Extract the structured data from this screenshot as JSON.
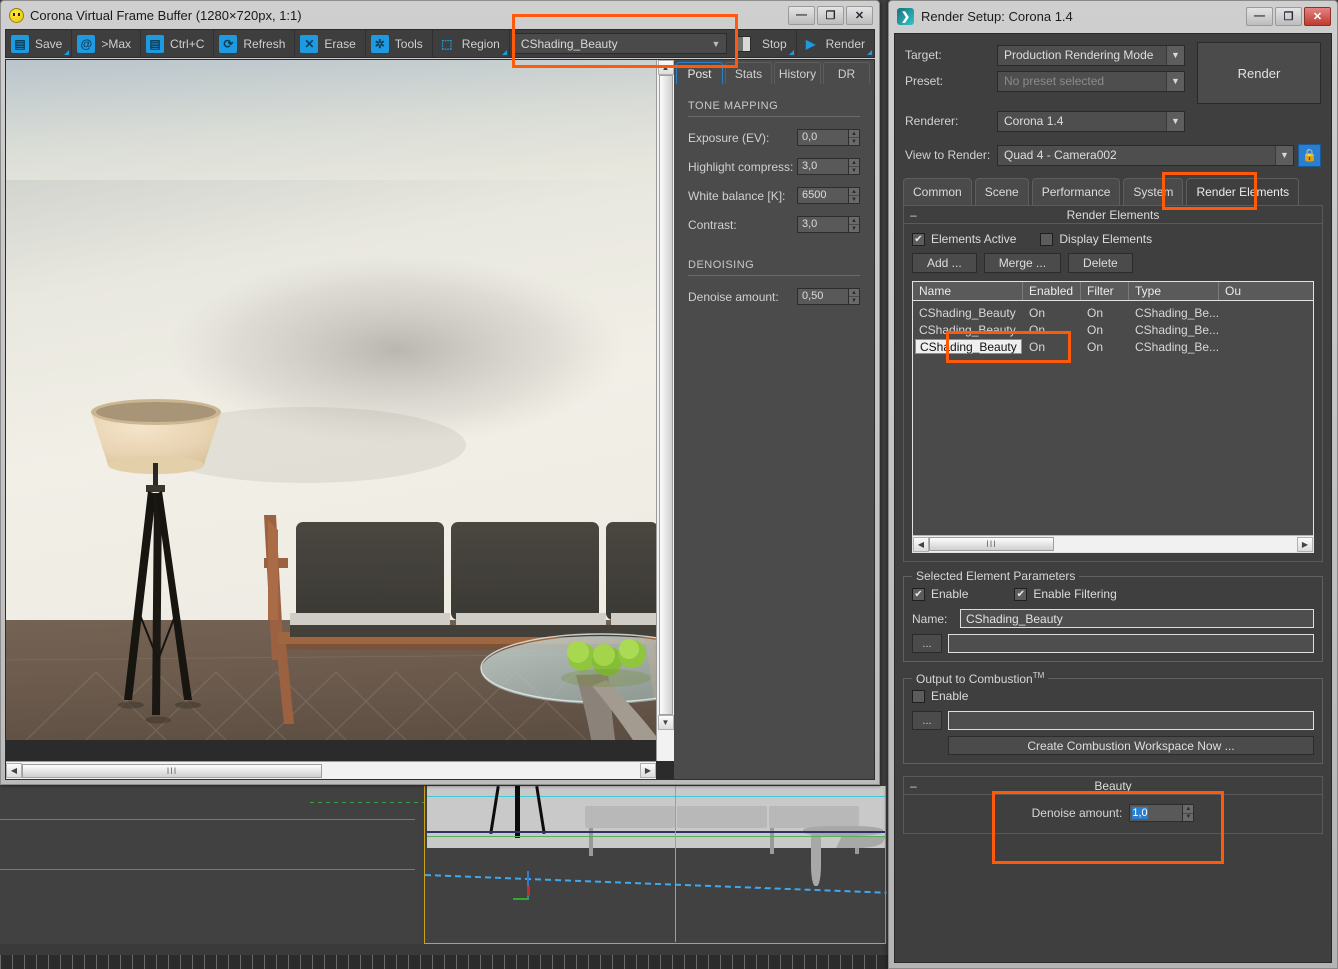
{
  "vfb": {
    "title": "Corona Virtual Frame Buffer (1280×720px, 1:1)",
    "icon": "smiley-icon",
    "window_buttons": {
      "minimize": "—",
      "maximize": "❐",
      "close": "✕"
    },
    "toolbar": [
      {
        "label": "Save",
        "icon": "save-icon",
        "glyph": "💾"
      },
      {
        "label": ">Max",
        "icon": "to-max-icon",
        "glyph": "@"
      },
      {
        "label": "Ctrl+C",
        "icon": "copy-icon",
        "glyph": "▤"
      },
      {
        "label": "Refresh",
        "icon": "refresh-icon",
        "glyph": "⟳"
      },
      {
        "label": "Erase",
        "icon": "erase-icon",
        "glyph": "✕"
      },
      {
        "label": "Tools",
        "icon": "gear-icon",
        "glyph": "✱"
      },
      {
        "label": "Region",
        "icon": "region-icon",
        "glyph": "⬚"
      }
    ],
    "element_combo": {
      "value": "CShading_Beauty",
      "chevron": "▼"
    },
    "stop_label": "Stop",
    "render_label": "Render",
    "render_icon": "play-icon",
    "tabs": [
      {
        "label": "Post",
        "active": true
      },
      {
        "label": "Stats",
        "active": false
      },
      {
        "label": "History",
        "active": false
      },
      {
        "label": "DR",
        "active": false
      }
    ],
    "post": {
      "tone_mapping_title": "TONE MAPPING",
      "tone_mapping": [
        {
          "label": "Exposure (EV):",
          "value": "0,0"
        },
        {
          "label": "Highlight compress:",
          "value": "3,0"
        },
        {
          "label": "White balance [K]:",
          "value": "6500"
        },
        {
          "label": "Contrast:",
          "value": "3,0"
        }
      ],
      "denoising_title": "DENOISING",
      "denoising": [
        {
          "label": "Denoise amount:",
          "value": "0,50"
        }
      ]
    },
    "scroll": {
      "h_grip": "III",
      "left_arrow": "◀",
      "right_arrow": "▶",
      "up_arrow": "▲",
      "down_arrow": "▼"
    }
  },
  "render_setup": {
    "title": "Render Setup: Corona 1.4",
    "icon": "corona-logo-icon",
    "window_buttons": {
      "minimize": "—",
      "maximize": "❐",
      "close": "✕"
    },
    "form": [
      {
        "label": "Target:",
        "value": "Production Rendering Mode",
        "disabled": false
      },
      {
        "label": "Preset:",
        "value": "No preset selected",
        "disabled": true
      },
      {
        "label": "Renderer:",
        "value": "Corona 1.4",
        "disabled": false
      }
    ],
    "view_to_render": {
      "label": "View to Render:",
      "value": "Quad 4 - Camera002",
      "lock_icon": "lock-icon"
    },
    "render_button": "Render",
    "tabs": [
      {
        "label": "Common",
        "active": false
      },
      {
        "label": "Scene",
        "active": false
      },
      {
        "label": "Performance",
        "active": false
      },
      {
        "label": "System",
        "active": false
      },
      {
        "label": "Render Elements",
        "active": true
      }
    ],
    "render_elements": {
      "rollout_title": "Render Elements",
      "minus": "–",
      "elements_active": {
        "label": "Elements Active",
        "checked": true
      },
      "display_elements": {
        "label": "Display Elements",
        "checked": false
      },
      "buttons": [
        "Add ...",
        "Merge ...",
        "Delete"
      ],
      "columns": [
        "Name",
        "Enabled",
        "Filter",
        "Type",
        "Ou"
      ],
      "rows": [
        {
          "name": "CShading_Beauty",
          "enabled": "On",
          "filter": "On",
          "type": "CShading_Be...",
          "editing": false
        },
        {
          "name": "CShading_Beauty",
          "enabled": "On",
          "filter": "On",
          "type": "CShading_Be...",
          "editing": false
        },
        {
          "name": "CShading_Beauty",
          "enabled": "On",
          "filter": "On",
          "type": "CShading_Be...",
          "editing": true
        }
      ]
    },
    "selected_element_parameters": {
      "group_label": "Selected Element Parameters",
      "enable": {
        "label": "Enable",
        "checked": true
      },
      "enable_filtering": {
        "label": "Enable Filtering",
        "checked": true
      },
      "name_label": "Name:",
      "name_value": "CShading_Beauty",
      "browse_label": "...",
      "path_value": ""
    },
    "output_to_combustion": {
      "group_label": "Output to Combustion",
      "trademark": "TM",
      "enable": {
        "label": "Enable",
        "checked": false
      },
      "browse_label": "...",
      "path_value": "",
      "create_button": "Create Combustion Workspace Now ..."
    },
    "beauty": {
      "rollout_title": "Beauty",
      "minus": "–",
      "denoise_label": "Denoise amount:",
      "denoise_value": "1,0"
    }
  },
  "annotations": {
    "color": "#ff5a0a",
    "boxes": [
      "vfb-element-combo-highlight",
      "render-elements-tab-highlight",
      "list-name-edit-highlight",
      "beauty-denoise-highlight"
    ]
  },
  "colors": {
    "accent_blue": "#1e9ae0",
    "highlight_orange": "#ff5a0a",
    "selection_blue": "#2b7fd0",
    "panel_gray": "#3f3f3f",
    "chrome_gray": "#cfcfcf"
  }
}
